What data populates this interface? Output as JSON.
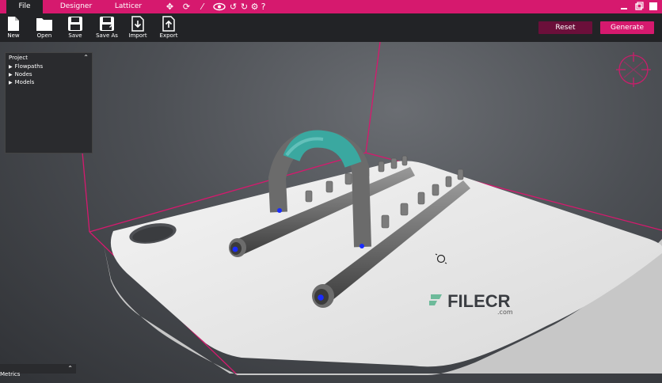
{
  "menubar": {
    "tabs": [
      {
        "label": "File",
        "active": true
      },
      {
        "label": "Designer",
        "active": false
      },
      {
        "label": "Latticer",
        "active": false
      }
    ],
    "icons": [
      "move-icon",
      "rotate-icon",
      "wand-icon",
      "eye-icon",
      "undo-icon",
      "redo-icon",
      "settings-icon",
      "help-icon"
    ],
    "window_controls": [
      "minimize-icon",
      "restore-icon",
      "close-icon"
    ]
  },
  "toolbar": {
    "new_label": "New",
    "open_label": "Open",
    "save_label": "Save",
    "save_as_label": "Save As",
    "import_label": "Import",
    "export_label": "Export",
    "reset_label": "Reset",
    "generate_label": "Generate"
  },
  "project_panel": {
    "title": "Project",
    "items": [
      {
        "label": "Flowpaths"
      },
      {
        "label": "Nodes"
      },
      {
        "label": "Models"
      }
    ]
  },
  "metrics_panel": {
    "title": "Metrics"
  },
  "watermark": {
    "brand": "FILECR",
    "suffix": ".com"
  },
  "colors": {
    "accent": "#d6196e",
    "reset": "#6b0f3a",
    "toolbar": "#222326",
    "panel": "#2a2b2e",
    "teal": "#3aa8a0"
  }
}
